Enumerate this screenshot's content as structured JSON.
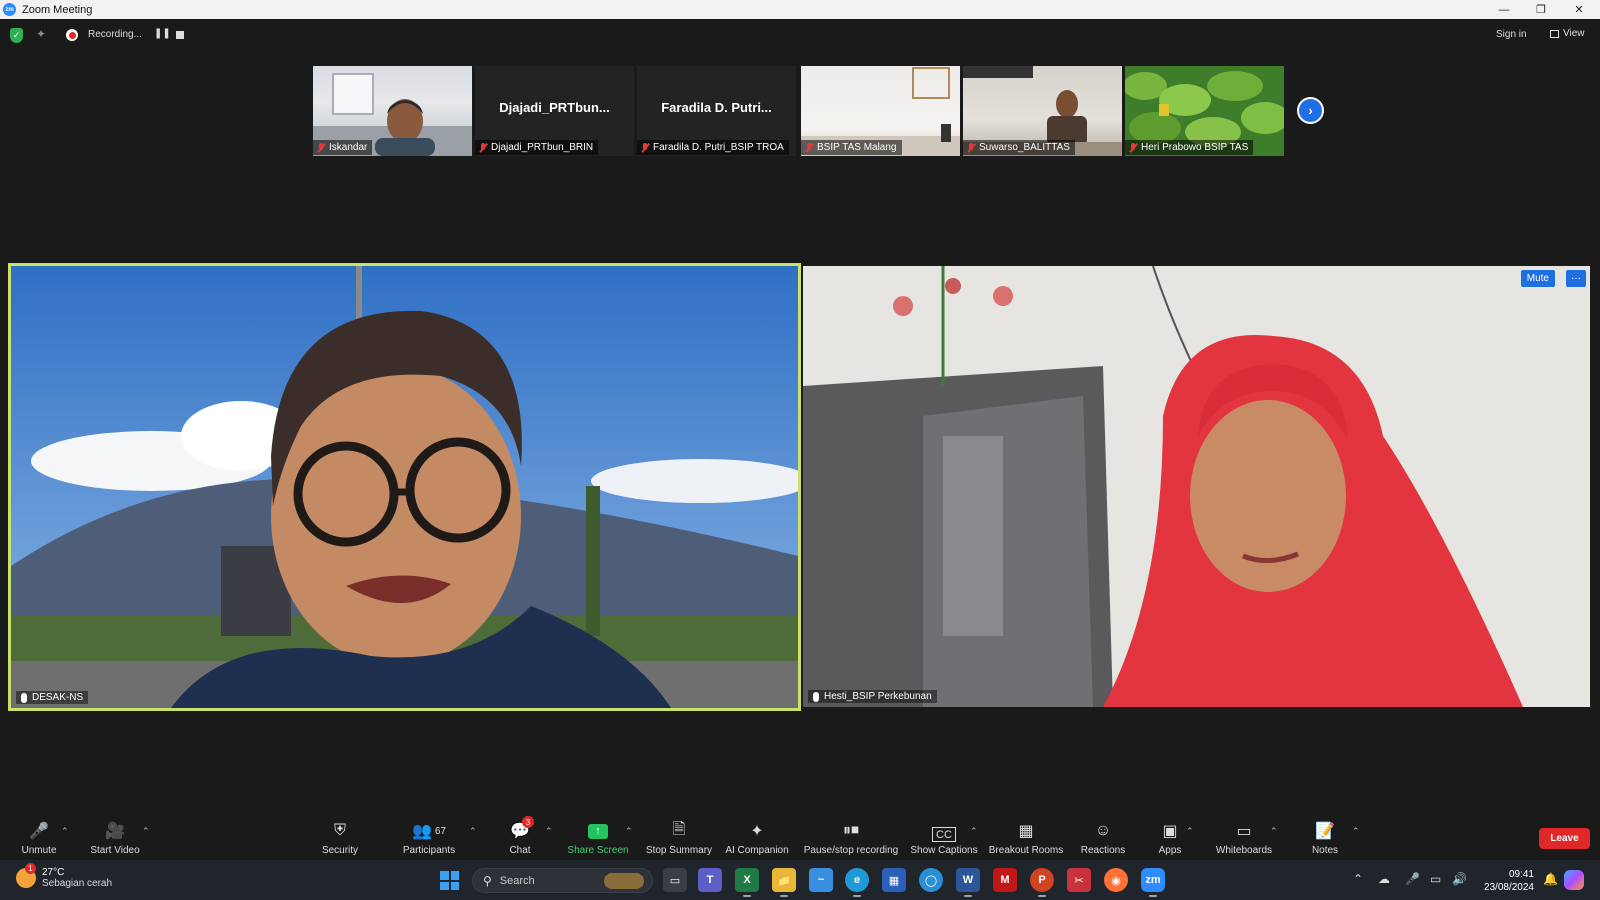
{
  "window": {
    "title": "Zoom Meeting",
    "app_icon": "zm",
    "controls": [
      "minimize-icon",
      "restore-icon",
      "close-icon"
    ]
  },
  "topbar": {
    "recording_label": "Recording...",
    "sign_in": "Sign in",
    "view": "View",
    "security_color": "#2fb052"
  },
  "participants_strip": [
    {
      "name": "Iskandar",
      "has_video": true
    },
    {
      "name": "Djajadi_PRTbun_BRIN",
      "display_short": "Djajadi_PRTbun...",
      "has_video": false
    },
    {
      "name": "Faradila D. Putri_BSIP TROA",
      "display_short": "Faradila D. Putri...",
      "has_video": false
    },
    {
      "name": "BSIP TAS Malang",
      "has_video": true
    },
    {
      "name": "Suwarso_BALITTAS",
      "has_video": true
    },
    {
      "name": "Heri Prabowo BSIP TAS",
      "has_video": true
    }
  ],
  "main_tiles": [
    {
      "name": "DESAK-NS",
      "active_speaker": true,
      "highlight_color": "#c9e26b"
    },
    {
      "name": "Hesti_BSIP Perkebunan",
      "mute_label": "Mute",
      "more_label": "···"
    }
  ],
  "toolbar": {
    "items": [
      {
        "label": "Unmute",
        "icon": "mic-muted-icon"
      },
      {
        "label": "Start Video",
        "icon": "video-off-icon"
      },
      {
        "label": "Security",
        "icon": "shield-icon"
      },
      {
        "label": "Participants",
        "icon": "participants-icon",
        "count": "67"
      },
      {
        "label": "Chat",
        "icon": "chat-icon",
        "badge": "3"
      },
      {
        "label": "Share Screen",
        "icon": "share-screen-icon"
      },
      {
        "label": "Stop Summary",
        "icon": "summary-icon"
      },
      {
        "label": "AI Companion",
        "icon": "ai-sparkle-icon"
      },
      {
        "label": "Pause/stop recording",
        "icon": "pause-stop-icon"
      },
      {
        "label": "Show Captions",
        "icon": "cc-icon"
      },
      {
        "label": "Breakout Rooms",
        "icon": "breakout-icon"
      },
      {
        "label": "Reactions",
        "icon": "reactions-icon"
      },
      {
        "label": "Apps",
        "icon": "apps-icon"
      },
      {
        "label": "Whiteboards",
        "icon": "whiteboard-icon"
      },
      {
        "label": "Notes",
        "icon": "notes-icon"
      }
    ],
    "leave": "Leave",
    "leave_color": "#e02828"
  },
  "taskbar": {
    "weather": {
      "temp": "27°C",
      "condition": "Sebagian cerah",
      "badge": "1"
    },
    "search_placeholder": "Search",
    "apps": [
      "task-view-icon",
      "teams-icon",
      "excel-icon",
      "file-explorer-icon",
      "app-icon",
      "edge-icon",
      "store-icon",
      "browser-icon",
      "word-icon",
      "mcafee-icon",
      "powerpoint-icon",
      "snipping-icon",
      "firefox-icon",
      "zoom-icon"
    ],
    "clock": {
      "time": "09:41",
      "date": "23/08/2024"
    }
  }
}
